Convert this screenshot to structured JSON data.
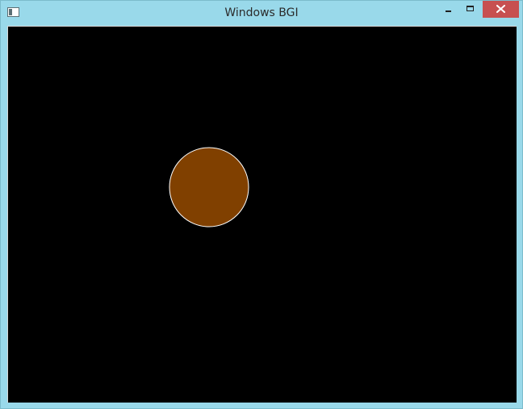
{
  "window": {
    "title": "Windows BGI",
    "frame_color": "#99d9ea",
    "close_color": "#c75050",
    "icons": {
      "app": "app-window-icon",
      "minimize": "minimize-icon",
      "maximize": "maximize-icon",
      "close": "close-icon"
    }
  },
  "canvas": {
    "background": "#000000",
    "circle": {
      "fill": "#804000",
      "outline": "#ffffff"
    }
  }
}
